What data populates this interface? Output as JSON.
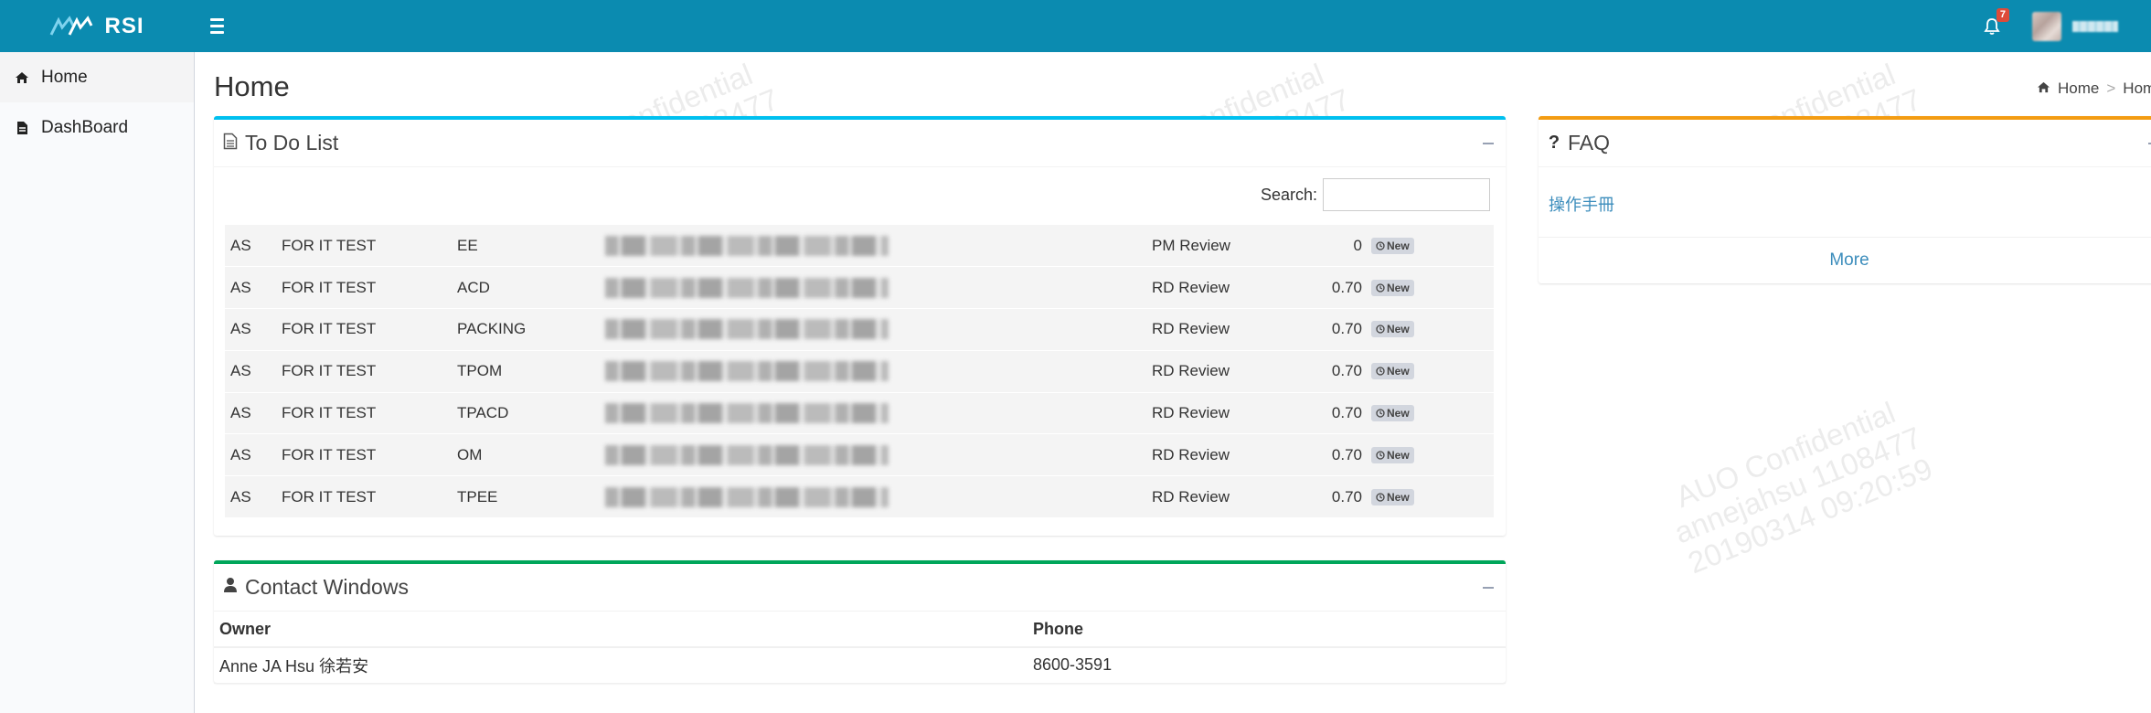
{
  "app": {
    "logo_text": "RSI",
    "notification_count": "7"
  },
  "sidebar": {
    "items": [
      {
        "label": "Home"
      },
      {
        "label": "DashBoard"
      }
    ]
  },
  "page": {
    "title": "Home",
    "breadcrumb_home": "Home",
    "breadcrumb_current": "Hom"
  },
  "todo": {
    "title": "To Do List",
    "search_label": "Search:",
    "badge_label": "New",
    "rows": [
      {
        "c1": "AS",
        "c2": "FOR IT TEST",
        "c3": "EE",
        "status": "PM Review",
        "value": "0"
      },
      {
        "c1": "AS",
        "c2": "FOR IT TEST",
        "c3": "ACD",
        "status": "RD Review",
        "value": "0.70"
      },
      {
        "c1": "AS",
        "c2": "FOR IT TEST",
        "c3": "PACKING",
        "status": "RD Review",
        "value": "0.70"
      },
      {
        "c1": "AS",
        "c2": "FOR IT TEST",
        "c3": "TPOM",
        "status": "RD Review",
        "value": "0.70"
      },
      {
        "c1": "AS",
        "c2": "FOR IT TEST",
        "c3": "TPACD",
        "status": "RD Review",
        "value": "0.70"
      },
      {
        "c1": "AS",
        "c2": "FOR IT TEST",
        "c3": "OM",
        "status": "RD Review",
        "value": "0.70"
      },
      {
        "c1": "AS",
        "c2": "FOR IT TEST",
        "c3": "TPEE",
        "status": "RD Review",
        "value": "0.70"
      }
    ]
  },
  "contact": {
    "title": "Contact Windows",
    "headers": {
      "owner": "Owner",
      "phone": "Phone"
    },
    "rows": [
      {
        "owner": "Anne JA Hsu 徐若安",
        "phone": "8600-3591"
      }
    ]
  },
  "faq": {
    "title": "FAQ",
    "link": "操作手冊",
    "more": "More"
  },
  "watermark": {
    "line1": "AUO Confidential",
    "line2": "annejahsu 1108477",
    "line3": "20190314 09:20:59"
  },
  "colors": {
    "topbar": "#0b8bb0",
    "todo_border": "#00c0ef",
    "contact_border": "#00a65a",
    "faq_border": "#f39c12",
    "link": "#3c8dbc",
    "badge": "#dd4b39"
  }
}
